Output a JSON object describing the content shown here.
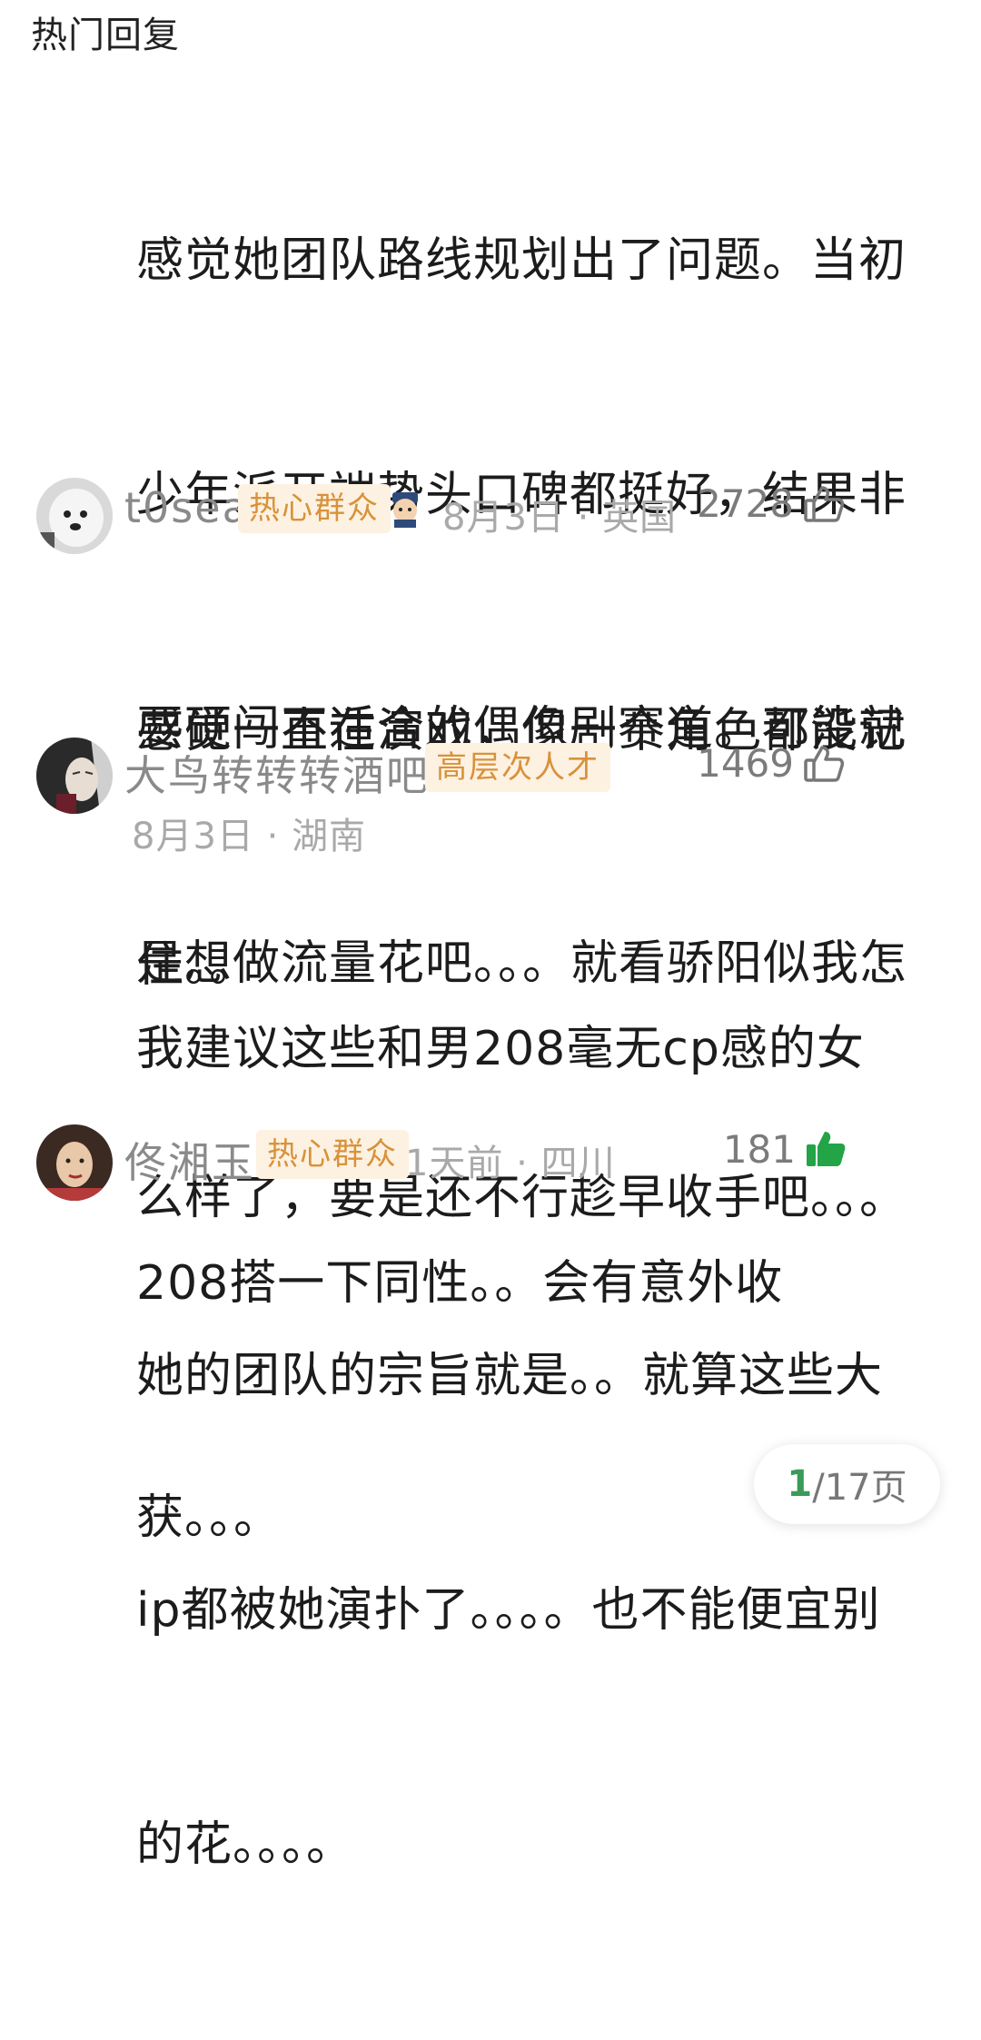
{
  "section_title": "热门回复",
  "top_comment": {
    "lines": [
      "感觉她团队路线规划出了问题。当初",
      "少年派开端势头口碑都挺好，结果非",
      "要硬闯不适合的偶像剧赛道。可能就",
      "是想做流量花吧。。。就看骄阳似我怎",
      "么样了，要是还不行趁早收手吧。。。"
    ]
  },
  "comments": [
    {
      "username": "t0sea",
      "badge": "热心群众",
      "date": "8月3日",
      "location": "英国",
      "likes": "2728",
      "lines": [
        "感觉一直在演戏，但一个角色都没记",
        "住。。"
      ]
    },
    {
      "username": "大鸟转转转酒吧",
      "badge": "高层次人才",
      "date": "8月3日",
      "location": "湖南",
      "likes": "1469",
      "lines": [
        "我建议这些和男208毫无cp感的女",
        "208搭一下同性。。会有意外收",
        "获。。。"
      ]
    },
    {
      "username": "佟湘玉",
      "badge": "热心群众",
      "date": "1天前",
      "location": "四川",
      "likes": "181",
      "lines": [
        "她的团队的宗旨就是。。就算这些大",
        "ip都被她演扑了。。。。也不能便宜别",
        "的花。。。。"
      ]
    }
  ],
  "pager": {
    "current": "1",
    "total": "/17页"
  },
  "colors": {
    "badge_bg": "#fdf1e1",
    "badge_text": "#d8923a",
    "liked_green": "#22a447"
  }
}
